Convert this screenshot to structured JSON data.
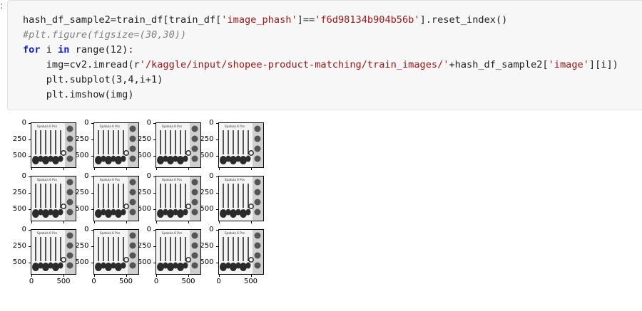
{
  "cell": {
    "gutter_glyph": ":",
    "code_lines": [
      [
        {
          "t": "hash_df_sample2=train_df[train_df[",
          "c": "op"
        },
        {
          "t": "'image_phash'",
          "c": "str"
        },
        {
          "t": "]==",
          "c": "op"
        },
        {
          "t": "'f6d98134b904b56b'",
          "c": "str"
        },
        {
          "t": "].reset_index()",
          "c": "op"
        }
      ],
      [
        {
          "t": "#plt.figure(figsize=(30,30))",
          "c": "cmt"
        }
      ],
      [
        {
          "t": "for",
          "c": "kw"
        },
        {
          "t": " i ",
          "c": "op"
        },
        {
          "t": "in",
          "c": "kw"
        },
        {
          "t": " range(12):",
          "c": "op"
        }
      ],
      [
        {
          "t": "    img=cv2.imread(r",
          "c": "op"
        },
        {
          "t": "'/kaggle/input/shopee-product-matching/train_images/'",
          "c": "str"
        },
        {
          "t": "+hash_df_sample2[",
          "c": "op"
        },
        {
          "t": "'image'",
          "c": "str"
        },
        {
          "t": "][i])",
          "c": "op"
        }
      ],
      [
        {
          "t": "    plt.subplot(3,4,i+1)",
          "c": "op"
        }
      ],
      [
        {
          "t": "    plt.imshow(img)",
          "c": "op"
        }
      ]
    ]
  },
  "output": {
    "subplot_title": "Spatula 6 Pcs",
    "y_ticks": [
      "0",
      "250",
      "500"
    ],
    "x_ticks": [
      "0",
      "500"
    ],
    "rows": 3,
    "cols": 4,
    "colors": {
      "utensil": "#2b2b2b",
      "background": "#f4f4f4",
      "right_panel": "#cfcfcf"
    }
  }
}
